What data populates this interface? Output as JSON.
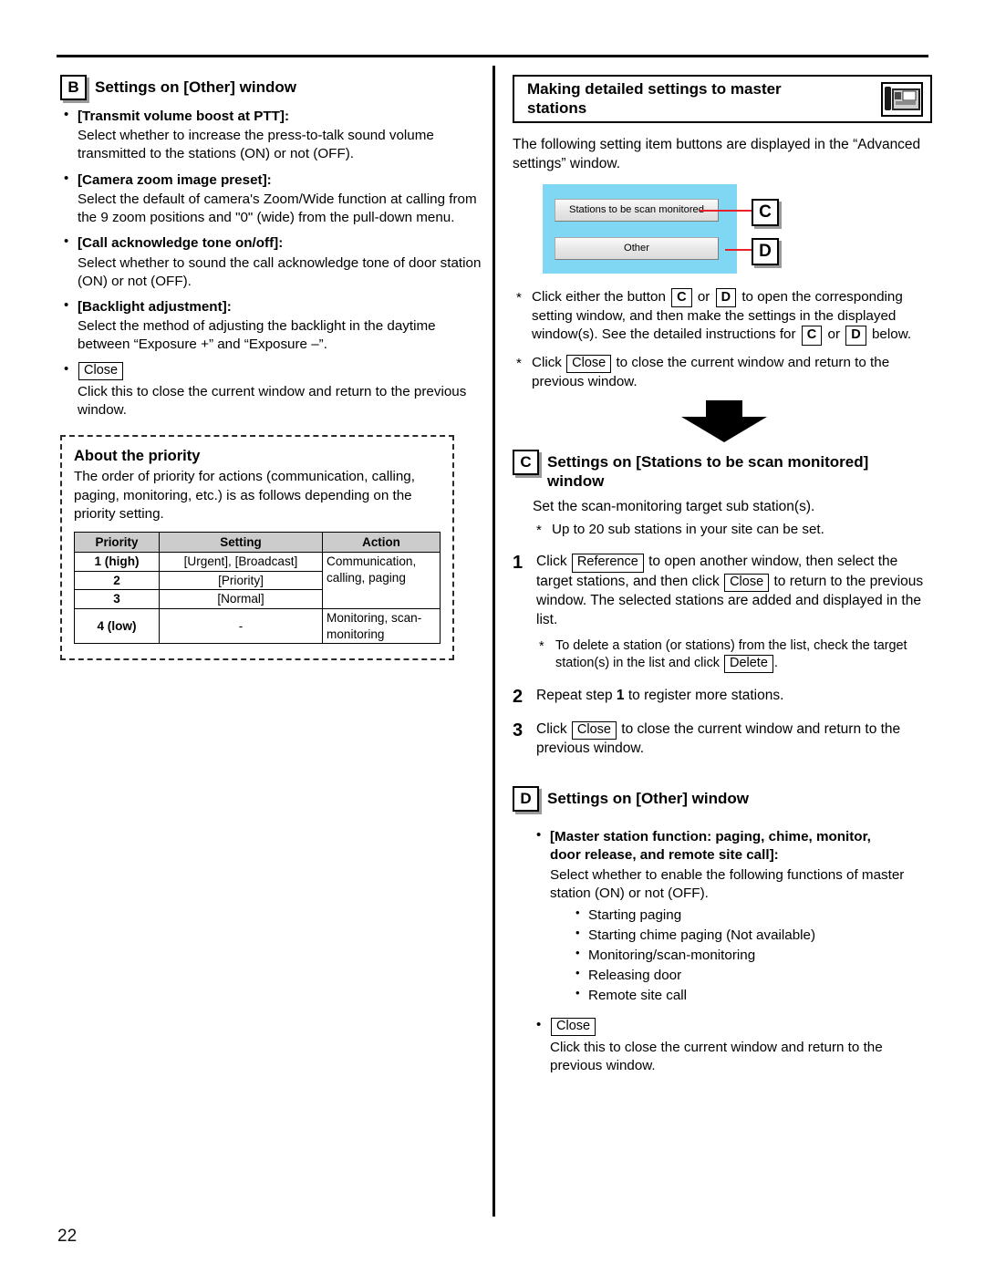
{
  "page": {
    "number": "22"
  },
  "left_column": {
    "section_b": {
      "letter": "B",
      "title": "Settings on [Other] window",
      "items": [
        {
          "term": "[Transmit volume boost at PTT]:",
          "desc": "Select whether to increase the press-to-talk sound volume transmitted to the stations (ON) or not (OFF)."
        },
        {
          "term": "[Camera zoom image preset]:",
          "desc": "Select the default of camera's Zoom/Wide function at calling from the 9 zoom positions and \"0\" (wide) from the pull-down menu."
        },
        {
          "term": "[Call acknowledge tone on/off]:",
          "desc": "Select whether to sound the call acknowledge tone of door station (ON) or not (OFF)."
        },
        {
          "term": "[Backlight adjustment]:",
          "desc": "Select the method of adjusting the backlight in the daytime between “Exposure +” and “Exposure –”."
        }
      ],
      "close_item": {
        "button": "Close",
        "desc": "Click this to close the current window and return to the previous window."
      }
    },
    "priority_panel": {
      "heading": "About the priority",
      "intro": "The order of priority for actions (communication, calling, paging, monitoring, etc.) is as follows depending on the priority setting.",
      "table": {
        "headers": [
          "Priority",
          "Setting",
          "Action"
        ],
        "rows": [
          {
            "priority": "1 (high)",
            "setting": "[Urgent], [Broadcast]",
            "action": "Communication, calling, paging"
          },
          {
            "priority": "2",
            "setting": "[Priority]",
            "action": ""
          },
          {
            "priority": "3",
            "setting": "[Normal]",
            "action": ""
          },
          {
            "priority": "4 (low)",
            "setting": "-",
            "action": "Monitoring, scan-monitoring"
          }
        ]
      }
    }
  },
  "right_column": {
    "header": {
      "title_line1": "Making detailed settings to master",
      "title_line2": "stations",
      "icon": "intercom-master-station-icon"
    },
    "intro": "The following setting item buttons are displayed in the “Advanced settings” window.",
    "screenshot": {
      "button_1": "Stations to be scan monitored",
      "button_2": "Other",
      "callout_1": "C",
      "callout_2": "D",
      "panel_color": "#7fd7f4",
      "leader_color": "#e8202a"
    },
    "notes": {
      "note1_a": "Click either the button",
      "note1_or": "or",
      "note1_b": "to open the corresponding setting window, and then make the settings in the displayed window(s). See the detailed instructions for",
      "note1_c": "below.",
      "note1_btn_c": "C",
      "note1_btn_d": "D",
      "note2_a": "Click",
      "note2_btn": "Close",
      "note2_b": "to close the current window and return to the previous window."
    },
    "section_c": {
      "letter": "C",
      "title_line1": "Settings on [Stations to be scan monitored]",
      "title_line2": "window",
      "lead": "Set the scan-monitoring target sub station(s).",
      "star": "Up to 20 sub stations in your site can be set.",
      "steps": [
        {
          "num": "1",
          "text_a": "Click",
          "btn_1": "Reference",
          "text_b": "to open another window, then select the target stations, and then click",
          "btn_2": "Close",
          "text_c": "to return to the previous window.",
          "text_d": "The selected stations are added and displayed in the list.",
          "subnote_a": "To delete a station (or stations) from the list, check the target station(s) in the list and click",
          "subnote_btn": "Delete",
          "subnote_b": "."
        },
        {
          "num": "2",
          "text_a": "Repeat step",
          "bold_ref": "1",
          "text_b": "to register more stations."
        },
        {
          "num": "3",
          "text_a": "Click",
          "btn_1": "Close",
          "text_b": "to close the current window and return to the previous window."
        }
      ]
    },
    "section_d": {
      "letter": "D",
      "title": "Settings on [Other] window",
      "item": {
        "term_line1": "[Master station function: paging, chime, monitor,",
        "term_line2": "door release, and remote site call]:",
        "desc": "Select whether to enable the following functions of master station (ON) or not (OFF).",
        "functions": [
          "Starting paging",
          "Starting chime paging (Not available)",
          "Monitoring/scan-monitoring",
          "Releasing door",
          "Remote site call"
        ]
      },
      "close_item": {
        "button": "Close",
        "desc": "Click this to close the current window and return to the previous window."
      }
    }
  }
}
